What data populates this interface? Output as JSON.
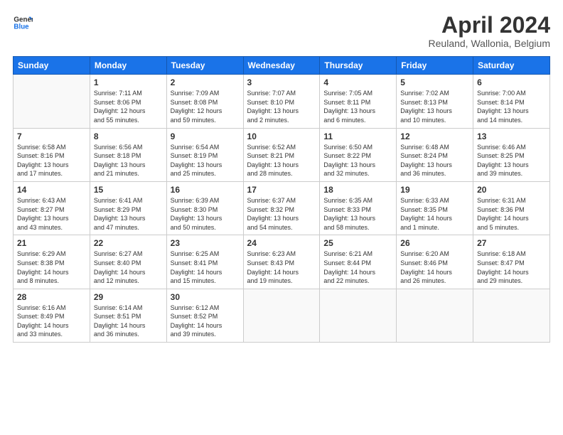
{
  "header": {
    "logo_line1": "General",
    "logo_line2": "Blue",
    "title": "April 2024",
    "location": "Reuland, Wallonia, Belgium"
  },
  "days_of_week": [
    "Sunday",
    "Monday",
    "Tuesday",
    "Wednesday",
    "Thursday",
    "Friday",
    "Saturday"
  ],
  "weeks": [
    [
      {
        "num": "",
        "info": ""
      },
      {
        "num": "1",
        "info": "Sunrise: 7:11 AM\nSunset: 8:06 PM\nDaylight: 12 hours\nand 55 minutes."
      },
      {
        "num": "2",
        "info": "Sunrise: 7:09 AM\nSunset: 8:08 PM\nDaylight: 12 hours\nand 59 minutes."
      },
      {
        "num": "3",
        "info": "Sunrise: 7:07 AM\nSunset: 8:10 PM\nDaylight: 13 hours\nand 2 minutes."
      },
      {
        "num": "4",
        "info": "Sunrise: 7:05 AM\nSunset: 8:11 PM\nDaylight: 13 hours\nand 6 minutes."
      },
      {
        "num": "5",
        "info": "Sunrise: 7:02 AM\nSunset: 8:13 PM\nDaylight: 13 hours\nand 10 minutes."
      },
      {
        "num": "6",
        "info": "Sunrise: 7:00 AM\nSunset: 8:14 PM\nDaylight: 13 hours\nand 14 minutes."
      }
    ],
    [
      {
        "num": "7",
        "info": "Sunrise: 6:58 AM\nSunset: 8:16 PM\nDaylight: 13 hours\nand 17 minutes."
      },
      {
        "num": "8",
        "info": "Sunrise: 6:56 AM\nSunset: 8:18 PM\nDaylight: 13 hours\nand 21 minutes."
      },
      {
        "num": "9",
        "info": "Sunrise: 6:54 AM\nSunset: 8:19 PM\nDaylight: 13 hours\nand 25 minutes."
      },
      {
        "num": "10",
        "info": "Sunrise: 6:52 AM\nSunset: 8:21 PM\nDaylight: 13 hours\nand 28 minutes."
      },
      {
        "num": "11",
        "info": "Sunrise: 6:50 AM\nSunset: 8:22 PM\nDaylight: 13 hours\nand 32 minutes."
      },
      {
        "num": "12",
        "info": "Sunrise: 6:48 AM\nSunset: 8:24 PM\nDaylight: 13 hours\nand 36 minutes."
      },
      {
        "num": "13",
        "info": "Sunrise: 6:46 AM\nSunset: 8:25 PM\nDaylight: 13 hours\nand 39 minutes."
      }
    ],
    [
      {
        "num": "14",
        "info": "Sunrise: 6:43 AM\nSunset: 8:27 PM\nDaylight: 13 hours\nand 43 minutes."
      },
      {
        "num": "15",
        "info": "Sunrise: 6:41 AM\nSunset: 8:29 PM\nDaylight: 13 hours\nand 47 minutes."
      },
      {
        "num": "16",
        "info": "Sunrise: 6:39 AM\nSunset: 8:30 PM\nDaylight: 13 hours\nand 50 minutes."
      },
      {
        "num": "17",
        "info": "Sunrise: 6:37 AM\nSunset: 8:32 PM\nDaylight: 13 hours\nand 54 minutes."
      },
      {
        "num": "18",
        "info": "Sunrise: 6:35 AM\nSunset: 8:33 PM\nDaylight: 13 hours\nand 58 minutes."
      },
      {
        "num": "19",
        "info": "Sunrise: 6:33 AM\nSunset: 8:35 PM\nDaylight: 14 hours\nand 1 minute."
      },
      {
        "num": "20",
        "info": "Sunrise: 6:31 AM\nSunset: 8:36 PM\nDaylight: 14 hours\nand 5 minutes."
      }
    ],
    [
      {
        "num": "21",
        "info": "Sunrise: 6:29 AM\nSunset: 8:38 PM\nDaylight: 14 hours\nand 8 minutes."
      },
      {
        "num": "22",
        "info": "Sunrise: 6:27 AM\nSunset: 8:40 PM\nDaylight: 14 hours\nand 12 minutes."
      },
      {
        "num": "23",
        "info": "Sunrise: 6:25 AM\nSunset: 8:41 PM\nDaylight: 14 hours\nand 15 minutes."
      },
      {
        "num": "24",
        "info": "Sunrise: 6:23 AM\nSunset: 8:43 PM\nDaylight: 14 hours\nand 19 minutes."
      },
      {
        "num": "25",
        "info": "Sunrise: 6:21 AM\nSunset: 8:44 PM\nDaylight: 14 hours\nand 22 minutes."
      },
      {
        "num": "26",
        "info": "Sunrise: 6:20 AM\nSunset: 8:46 PM\nDaylight: 14 hours\nand 26 minutes."
      },
      {
        "num": "27",
        "info": "Sunrise: 6:18 AM\nSunset: 8:47 PM\nDaylight: 14 hours\nand 29 minutes."
      }
    ],
    [
      {
        "num": "28",
        "info": "Sunrise: 6:16 AM\nSunset: 8:49 PM\nDaylight: 14 hours\nand 33 minutes."
      },
      {
        "num": "29",
        "info": "Sunrise: 6:14 AM\nSunset: 8:51 PM\nDaylight: 14 hours\nand 36 minutes."
      },
      {
        "num": "30",
        "info": "Sunrise: 6:12 AM\nSunset: 8:52 PM\nDaylight: 14 hours\nand 39 minutes."
      },
      {
        "num": "",
        "info": ""
      },
      {
        "num": "",
        "info": ""
      },
      {
        "num": "",
        "info": ""
      },
      {
        "num": "",
        "info": ""
      }
    ]
  ]
}
